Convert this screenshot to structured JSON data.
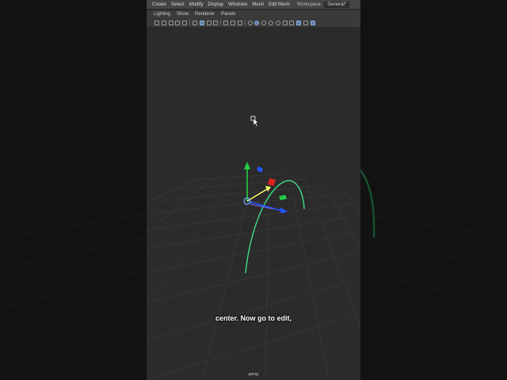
{
  "menubar": {
    "items": [
      "Create",
      "Select",
      "Modify",
      "Display",
      "Windows",
      "Mesh",
      "Edit Mesh"
    ],
    "workspace_label": "Workspace:",
    "workspace_value": "General*"
  },
  "panel_menu": {
    "items": [
      "Lighting",
      "Show",
      "Renderer",
      "Panels"
    ]
  },
  "viewport": {
    "camera": "persp",
    "curve_color": "#3fdf8a"
  },
  "subtitle": {
    "text": "center. Now go to edit,"
  },
  "colors": {
    "background": "#0e0e0e",
    "viewport": "#2b2b2b",
    "menubar": "#444444",
    "axis_y": "#22cc44",
    "axis_x": "#2255ff",
    "axis_z": "#dd2222",
    "pivot": "#ffff66"
  }
}
